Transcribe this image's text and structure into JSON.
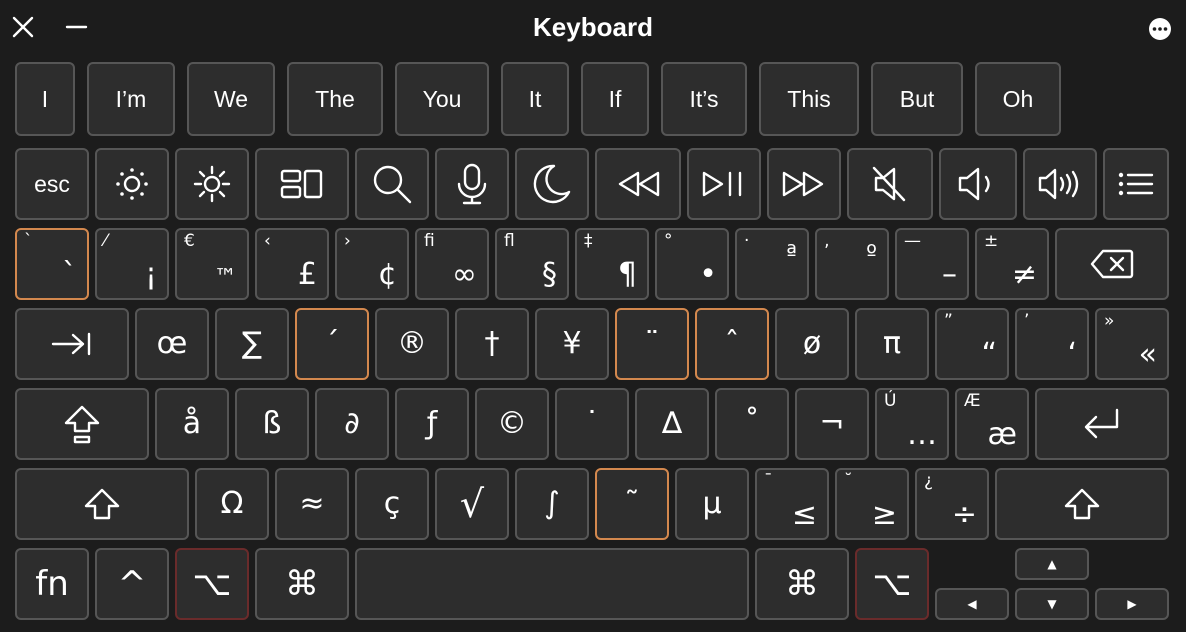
{
  "window": {
    "title": "Keyboard"
  },
  "suggestions": [
    "I",
    "I’m",
    "We",
    "The",
    "You",
    "It",
    "If",
    "It’s",
    "This",
    "But",
    "Oh"
  ],
  "function_row": {
    "esc": "esc"
  },
  "number_row": [
    {
      "sec": "`",
      "main": "`"
    },
    {
      "sec": "⁄",
      "main": "¡"
    },
    {
      "sec": "€",
      "main": "™"
    },
    {
      "sec": "‹",
      "main": "£"
    },
    {
      "sec": "›",
      "main": "¢"
    },
    {
      "sec": "ﬁ",
      "main": "∞"
    },
    {
      "sec": "ﬂ",
      "main": "§"
    },
    {
      "sec": "‡",
      "main": "¶"
    },
    {
      "sec": "°",
      "main": "•"
    },
    {
      "sec": "·",
      "main": "ª"
    },
    {
      "sec": "‚",
      "main": "º"
    },
    {
      "sec": "—",
      "main": "–"
    },
    {
      "sec": "±",
      "main": "≠"
    }
  ],
  "tab_row": [
    {
      "sec": "",
      "main": "œ"
    },
    {
      "sec": "",
      "main": "∑"
    },
    {
      "sec": "",
      "main": "´"
    },
    {
      "sec": "",
      "main": "®"
    },
    {
      "sec": "",
      "main": "†"
    },
    {
      "sec": "",
      "main": "¥"
    },
    {
      "sec": "",
      "main": "¨"
    },
    {
      "sec": "",
      "main": "ˆ"
    },
    {
      "sec": "",
      "main": "ø"
    },
    {
      "sec": "",
      "main": "π"
    },
    {
      "sec": "”",
      "main": "“"
    },
    {
      "sec": "’",
      "main": "‘"
    },
    {
      "sec": "»",
      "main": "«"
    }
  ],
  "caps_row": [
    {
      "sec": "",
      "main": "å"
    },
    {
      "sec": "",
      "main": "ß"
    },
    {
      "sec": "",
      "main": "∂"
    },
    {
      "sec": "",
      "main": "ƒ"
    },
    {
      "sec": "",
      "main": "©"
    },
    {
      "sec": "",
      "main": "˙"
    },
    {
      "sec": "",
      "main": "∆"
    },
    {
      "sec": "",
      "main": "˚"
    },
    {
      "sec": "",
      "main": "¬"
    },
    {
      "sec": "Ú",
      "main": "…"
    },
    {
      "sec": "Æ",
      "main": "æ"
    }
  ],
  "shift_row": [
    {
      "sec": "",
      "main": "Ω"
    },
    {
      "sec": "",
      "main": "≈"
    },
    {
      "sec": "",
      "main": "ç"
    },
    {
      "sec": "",
      "main": "√"
    },
    {
      "sec": "",
      "main": "∫"
    },
    {
      "sec": "",
      "main": "˜"
    },
    {
      "sec": "",
      "main": "µ"
    },
    {
      "sec": "¯",
      "main": "≤"
    },
    {
      "sec": "˘",
      "main": "≥"
    },
    {
      "sec": "¿",
      "main": "÷"
    }
  ],
  "bottom_row": {
    "fn": "fn",
    "control": "^",
    "option": "⌥",
    "command": "⌘",
    "up": "▲",
    "down": "▼",
    "left": "◀",
    "right": "▶"
  },
  "colors": {
    "background": "#1c1c1c",
    "key": "#2d2d2d",
    "key_border": "#565656",
    "dead_key_border": "#d3884e",
    "option_border": "#6a2b2b"
  }
}
